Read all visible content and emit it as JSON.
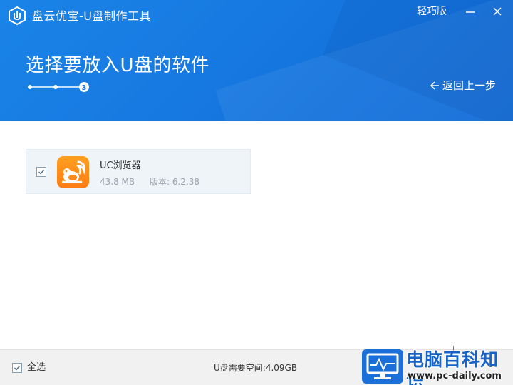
{
  "window": {
    "title": "盘云优宝-U盘制作工具",
    "edition_link": "轻巧版"
  },
  "header": {
    "heading": "选择要放入U盘的软件",
    "back_label": "返回上一步",
    "stepper": {
      "total_steps": 3,
      "current_step": 3,
      "current_label": "3"
    }
  },
  "apps": [
    {
      "name": "UC浏览器",
      "size": "43.8 MB",
      "version": "版本: 6.2.38",
      "checked": true,
      "icon": "uc-browser-icon"
    }
  ],
  "footer": {
    "select_all_label": "全选",
    "select_all_checked": true,
    "space_required": "U盘需要空间:4.09GB"
  },
  "watermark": {
    "title": "电脑百科知识",
    "url": "www.pc-daily.com"
  },
  "colors": {
    "header_blue": "#1677e0",
    "card_bg": "#eef4f8",
    "footer_bg": "#f1f1f1",
    "uc_orange": "#ff8a18"
  }
}
